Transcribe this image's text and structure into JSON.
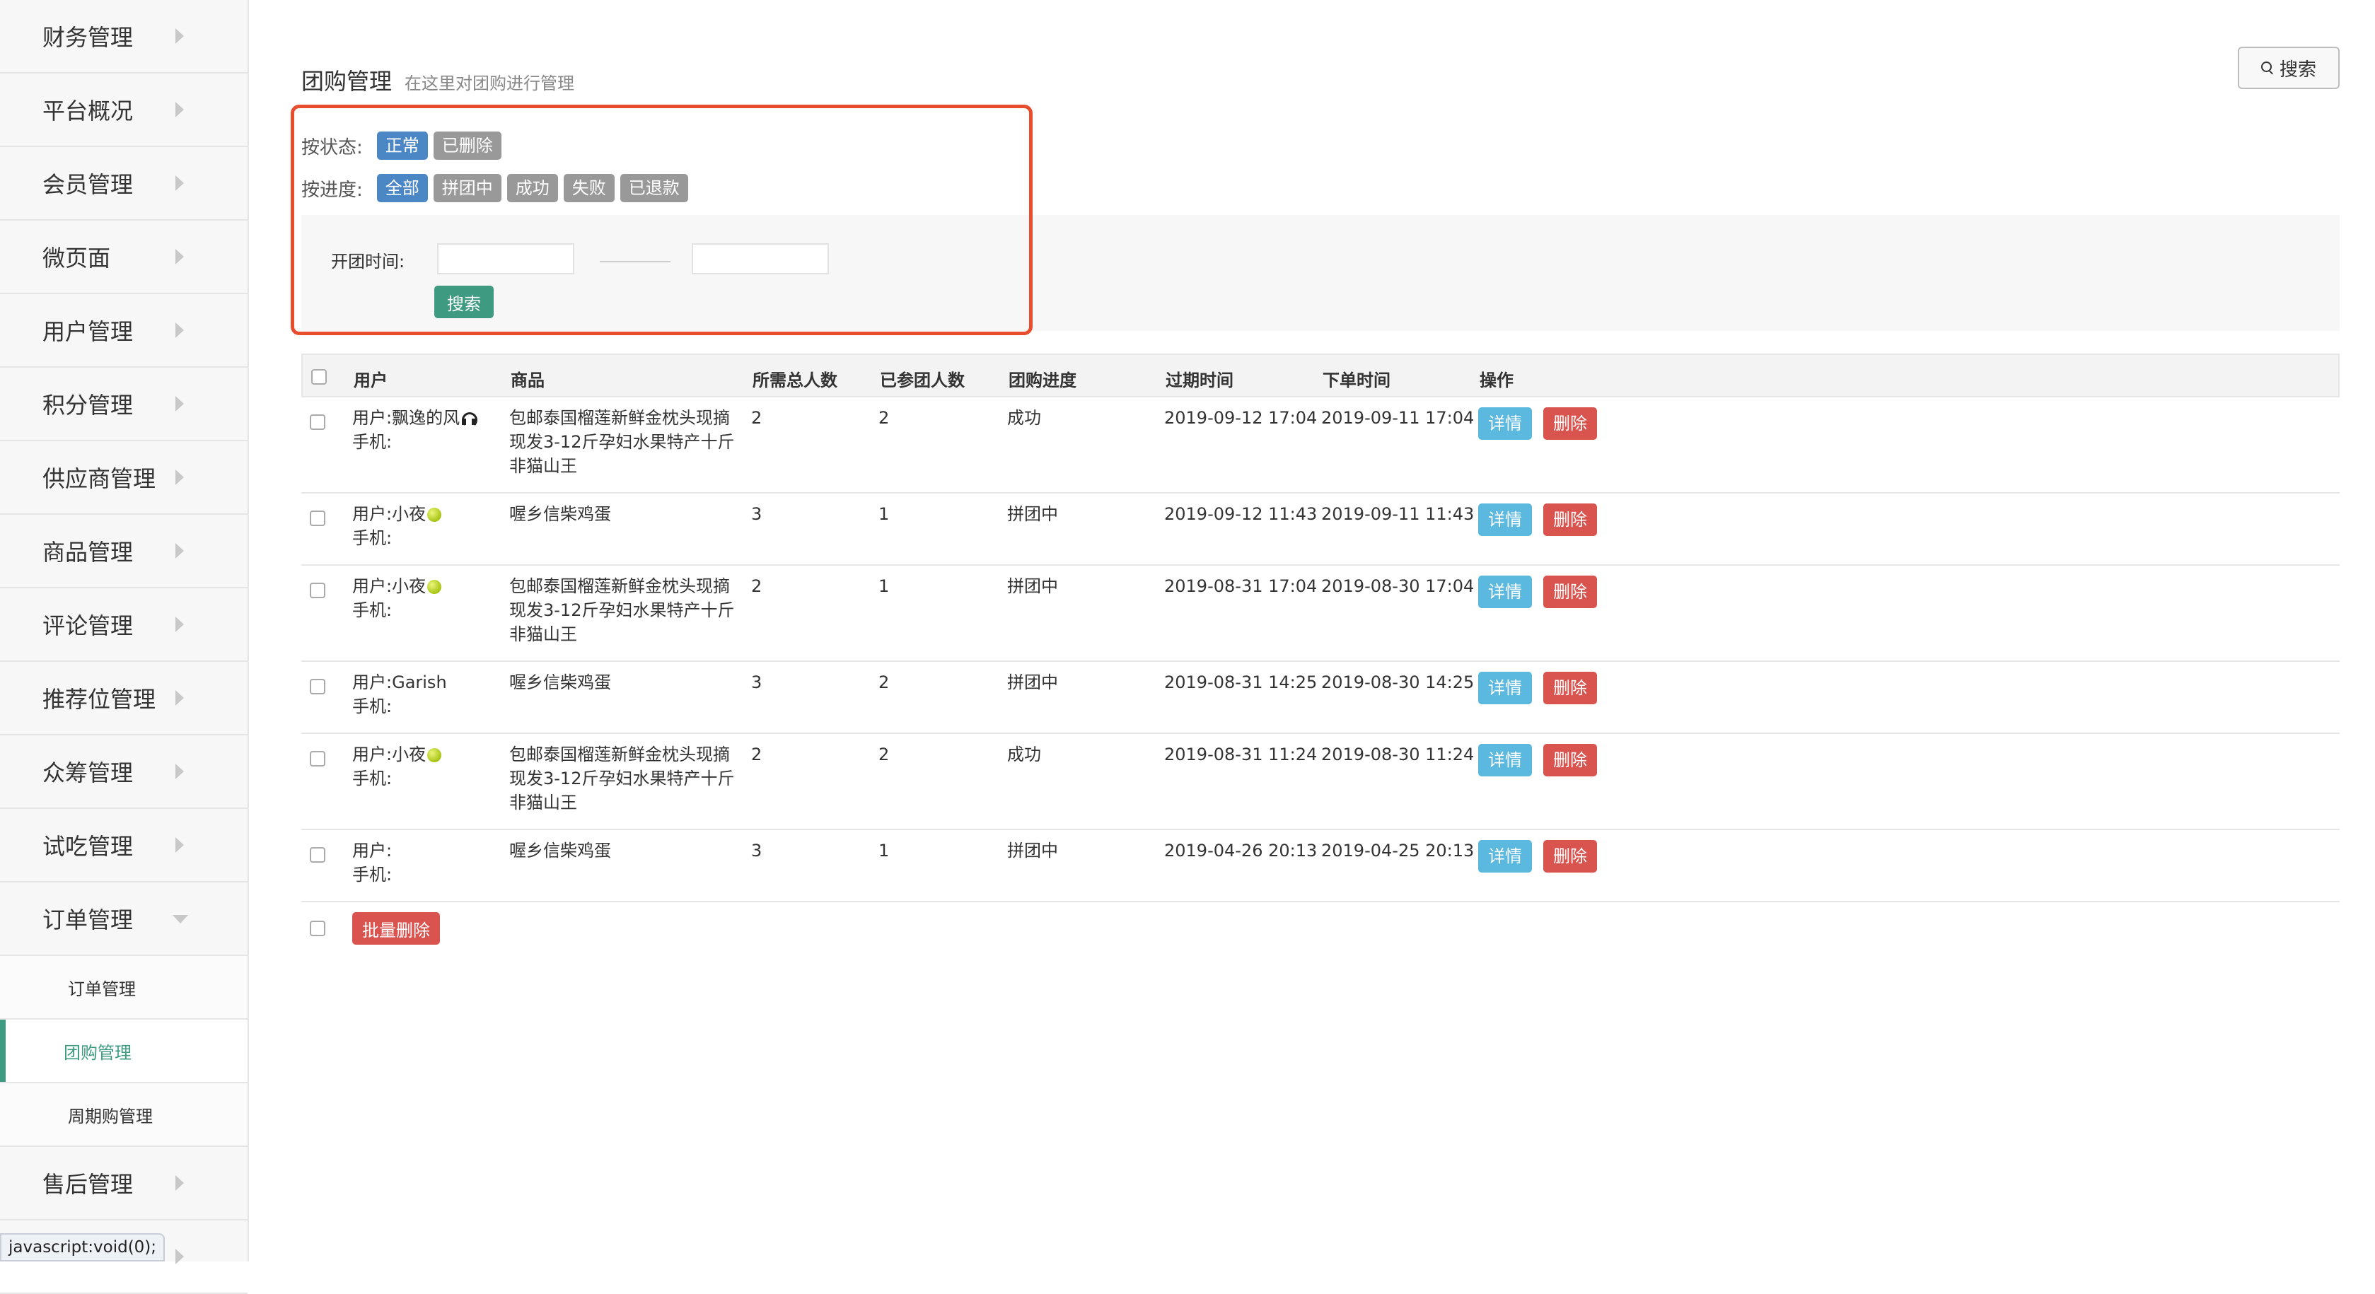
{
  "sidebar": {
    "items": [
      {
        "label": "财务管理"
      },
      {
        "label": "平台概况"
      },
      {
        "label": "会员管理"
      },
      {
        "label": "微页面"
      },
      {
        "label": "用户管理"
      },
      {
        "label": "积分管理"
      },
      {
        "label": "供应商管理"
      },
      {
        "label": "商品管理"
      },
      {
        "label": "评论管理"
      },
      {
        "label": "推荐位管理"
      },
      {
        "label": "众筹管理"
      },
      {
        "label": "试吃管理"
      },
      {
        "label": "订单管理"
      }
    ],
    "sub_items": [
      {
        "label": "订单管理"
      },
      {
        "label": "团购管理"
      },
      {
        "label": "周期购管理"
      }
    ],
    "after_items": [
      {
        "label": "售后管理"
      }
    ]
  },
  "statusbar": {
    "text": "javascript:void(0);"
  },
  "header": {
    "title": "团购管理",
    "subtitle": "在这里对团购进行管理",
    "search_btn": "搜索"
  },
  "filters": {
    "status_label": "按状态:",
    "status_tags": [
      {
        "label": "正常"
      },
      {
        "label": "已删除"
      }
    ],
    "progress_label": "按进度:",
    "progress_tags": [
      {
        "label": "全部"
      },
      {
        "label": "拼团中"
      },
      {
        "label": "成功"
      },
      {
        "label": "失败"
      },
      {
        "label": "已退款"
      }
    ],
    "date_label": "开团时间:",
    "date_start": "",
    "date_end": "",
    "search_btn": "搜索"
  },
  "table": {
    "headers": {
      "user": "用户",
      "goods": "商品",
      "required": "所需总人数",
      "joined": "已参团人数",
      "progress": "团购进度",
      "expire": "过期时间",
      "order_time": "下单时间",
      "action": "操作"
    },
    "user_prefix": "用户:",
    "phone_prefix": "手机:",
    "detail_btn": "详情",
    "delete_btn": "删除",
    "rows": [
      {
        "user": "飘逸的风",
        "icon": "headphone-icon",
        "goods": "包邮泰国榴莲新鲜金枕头现摘现发3-12斤孕妇水果特产十斤非猫山王",
        "required": "2",
        "joined": "2",
        "progress": "成功",
        "expire": "2019-09-12 17:04",
        "order_time": "2019-09-11 17:04"
      },
      {
        "user": "小夜",
        "icon": "tennis-ball-icon",
        "goods": "喔乡信柴鸡蛋",
        "required": "3",
        "joined": "1",
        "progress": "拼团中",
        "expire": "2019-09-12 11:43",
        "order_time": "2019-09-11 11:43"
      },
      {
        "user": "小夜",
        "icon": "tennis-ball-icon",
        "goods": "包邮泰国榴莲新鲜金枕头现摘现发3-12斤孕妇水果特产十斤非猫山王",
        "required": "2",
        "joined": "1",
        "progress": "拼团中",
        "expire": "2019-08-31 17:04",
        "order_time": "2019-08-30 17:04"
      },
      {
        "user": "Garish",
        "icon": "",
        "goods": "喔乡信柴鸡蛋",
        "required": "3",
        "joined": "2",
        "progress": "拼团中",
        "expire": "2019-08-31 14:25",
        "order_time": "2019-08-30 14:25"
      },
      {
        "user": "小夜",
        "icon": "tennis-ball-icon",
        "goods": "包邮泰国榴莲新鲜金枕头现摘现发3-12斤孕妇水果特产十斤非猫山王",
        "required": "2",
        "joined": "2",
        "progress": "成功",
        "expire": "2019-08-31 11:24",
        "order_time": "2019-08-30 11:24"
      },
      {
        "user": "",
        "icon": "",
        "goods": "喔乡信柴鸡蛋",
        "required": "3",
        "joined": "1",
        "progress": "拼团中",
        "expire": "2019-04-26 20:13",
        "order_time": "2019-04-25 20:13"
      }
    ],
    "batch_delete": "批量删除"
  },
  "colors": {
    "accent": "#3e9b82",
    "primary": "#4b86c5",
    "danger": "#d9534f",
    "info": "#5bb8de",
    "highlight": "#e84d2e"
  }
}
